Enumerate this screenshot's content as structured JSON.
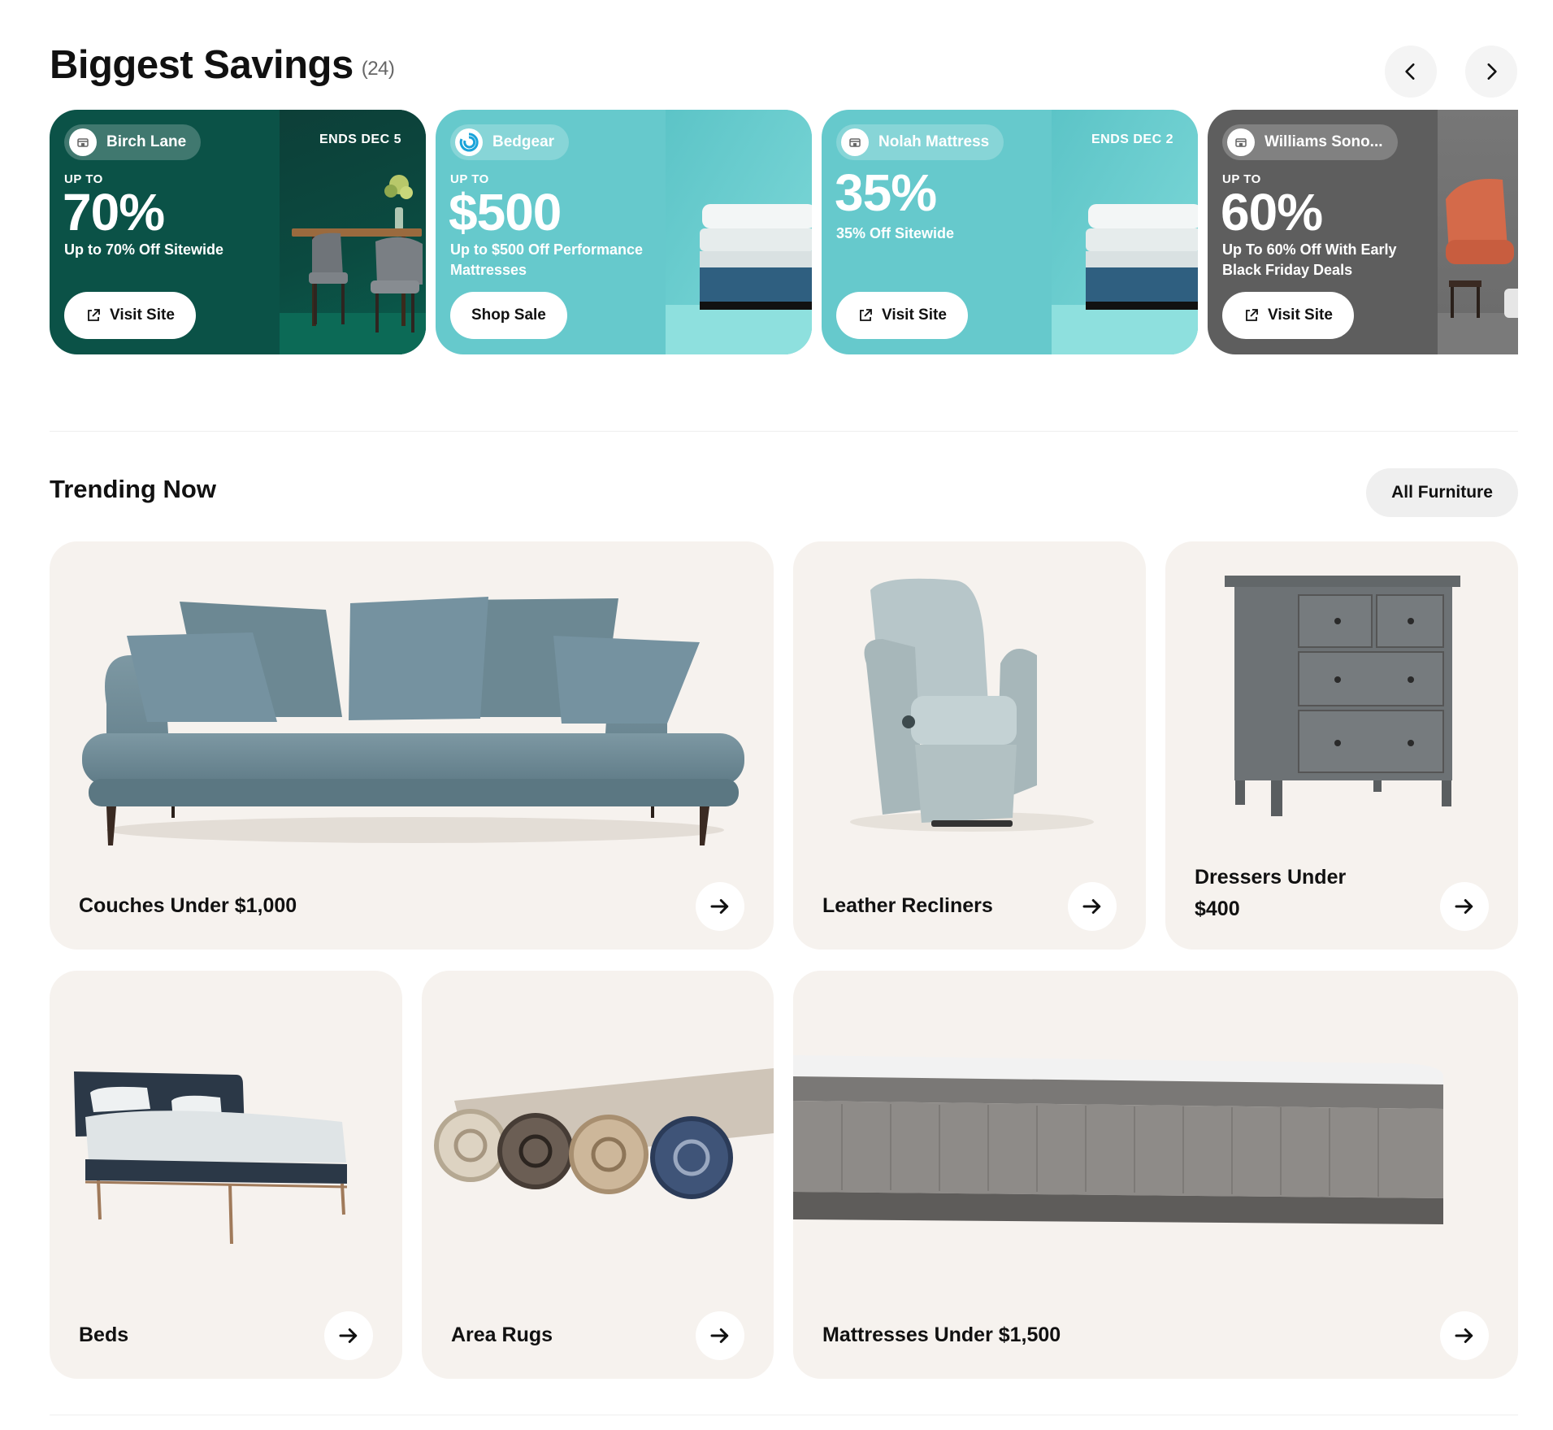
{
  "savings": {
    "title": "Biggest Savings",
    "count": "(24)",
    "deals": [
      {
        "store": "Birch Lane",
        "ends": "ENDS DEC 5",
        "upto": "UP TO",
        "amount": "70%",
        "description": "Up to 70% Off Sitewide",
        "cta": "Visit Site",
        "color": "#0b5247"
      },
      {
        "store": "Bedgear",
        "ends": "",
        "upto": "UP TO",
        "amount": "$500",
        "description": "Up to $500 Off Performance Mattresses",
        "cta": "Shop Sale",
        "color": "#66c9cc"
      },
      {
        "store": "Nolah Mattress",
        "ends": "ENDS DEC 2",
        "upto": "",
        "amount": "35%",
        "description": "35% Off Sitewide",
        "cta": "Visit Site",
        "color": "#66c9cc"
      },
      {
        "store": "Williams Sono...",
        "ends": "",
        "upto": "UP TO",
        "amount": "60%",
        "description": "Up To 60% Off With Early Black Friday Deals",
        "cta": "Visit Site",
        "color": "#5e5e5e"
      }
    ]
  },
  "trending": {
    "title": "Trending Now",
    "all_button": "All Furniture",
    "tiles": [
      {
        "label": "Couches Under $1,000"
      },
      {
        "label": "Leather Recliners"
      },
      {
        "label": "Dressers Under $400"
      },
      {
        "label": "Beds"
      },
      {
        "label": "Area Rugs"
      },
      {
        "label": "Mattresses Under $1,500"
      }
    ]
  },
  "icons": {
    "prev": "chevron-left-icon",
    "next": "chevron-right-icon",
    "external": "external-link-icon",
    "arrow": "arrow-right-icon",
    "store": "store-icon"
  }
}
